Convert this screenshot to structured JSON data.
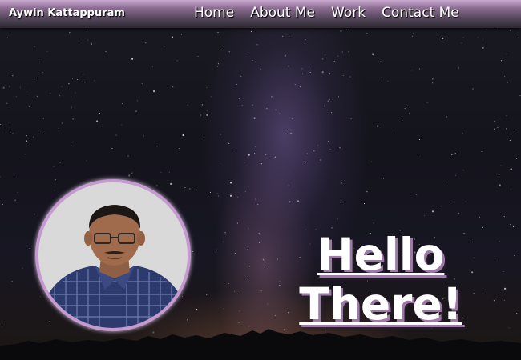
{
  "header": {
    "brand": "Aywin Kattappuram",
    "nav": [
      {
        "label": "Home"
      },
      {
        "label": "About Me"
      },
      {
        "label": "Work"
      },
      {
        "label": "Contact Me"
      }
    ]
  },
  "hero": {
    "heading_line1": "Hello",
    "heading_line2": "There!"
  },
  "colors": {
    "accent": "#c59ad0",
    "nav_gradient_top": "#c9a9cf",
    "text": "#ffffff",
    "background": "#14141c"
  }
}
